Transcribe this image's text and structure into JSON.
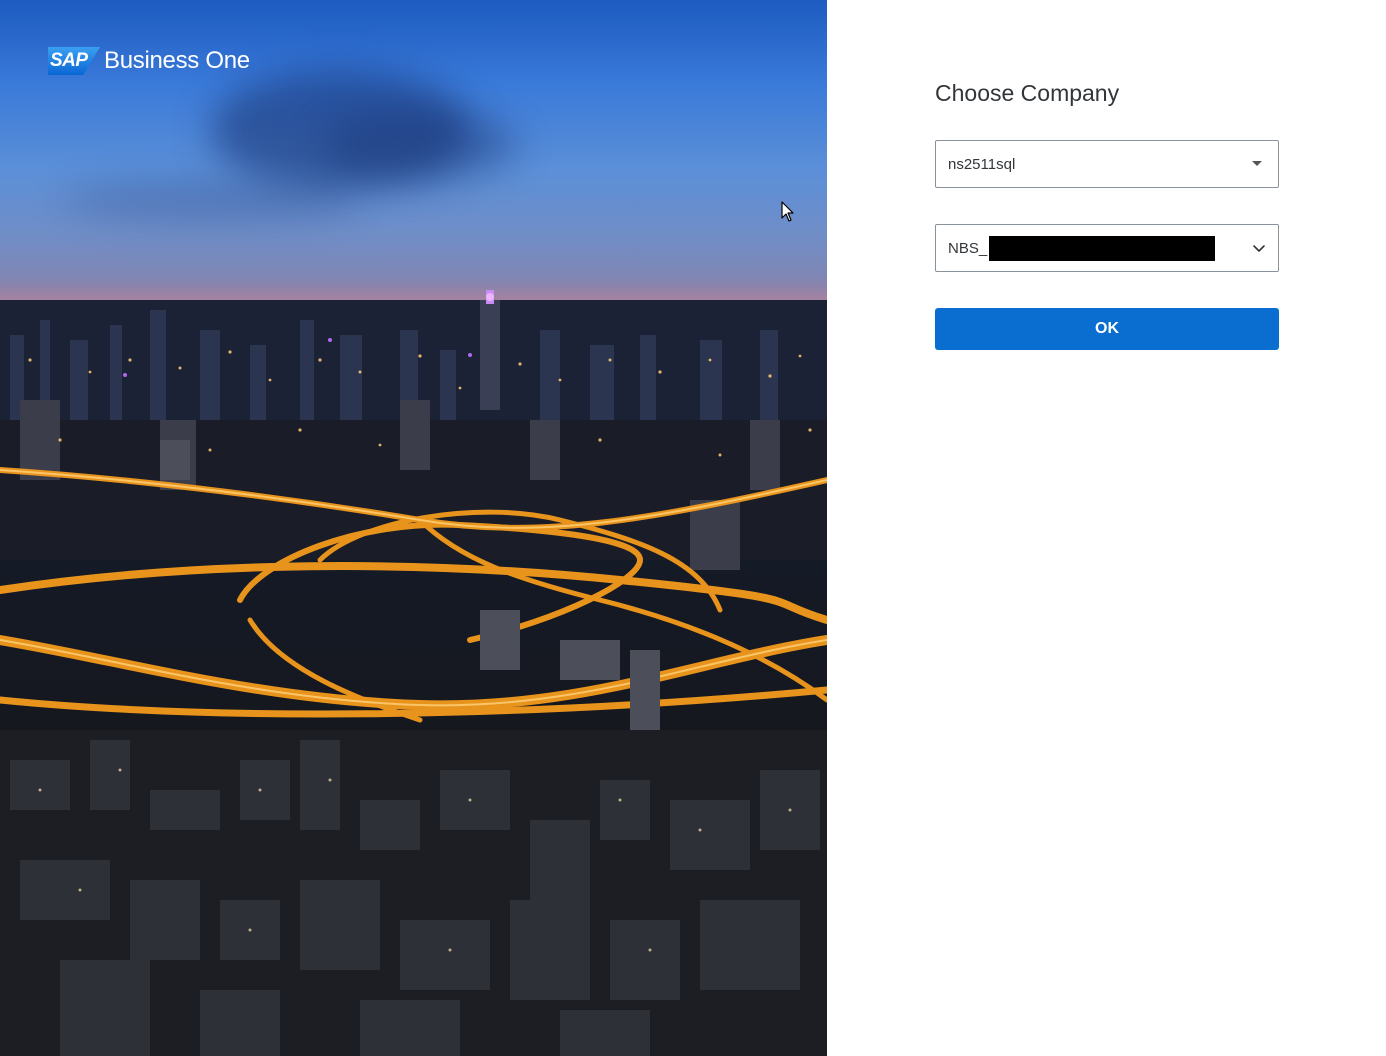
{
  "brand": {
    "badge": "SAP",
    "product": "Business One"
  },
  "form": {
    "title": "Choose Company",
    "server_value": "ns2511sql",
    "company_value_prefix": "NBS_",
    "ok_label": "OK"
  },
  "icons": {
    "server_dropdown": "caret-down-icon",
    "company_dropdown": "chevron-down-icon",
    "pointer": "mouse-pointer-icon"
  },
  "colors": {
    "primary_button": "#0a6ed1",
    "logo_blue": "#1478e0",
    "text": "#32363a",
    "border": "#89919a"
  }
}
